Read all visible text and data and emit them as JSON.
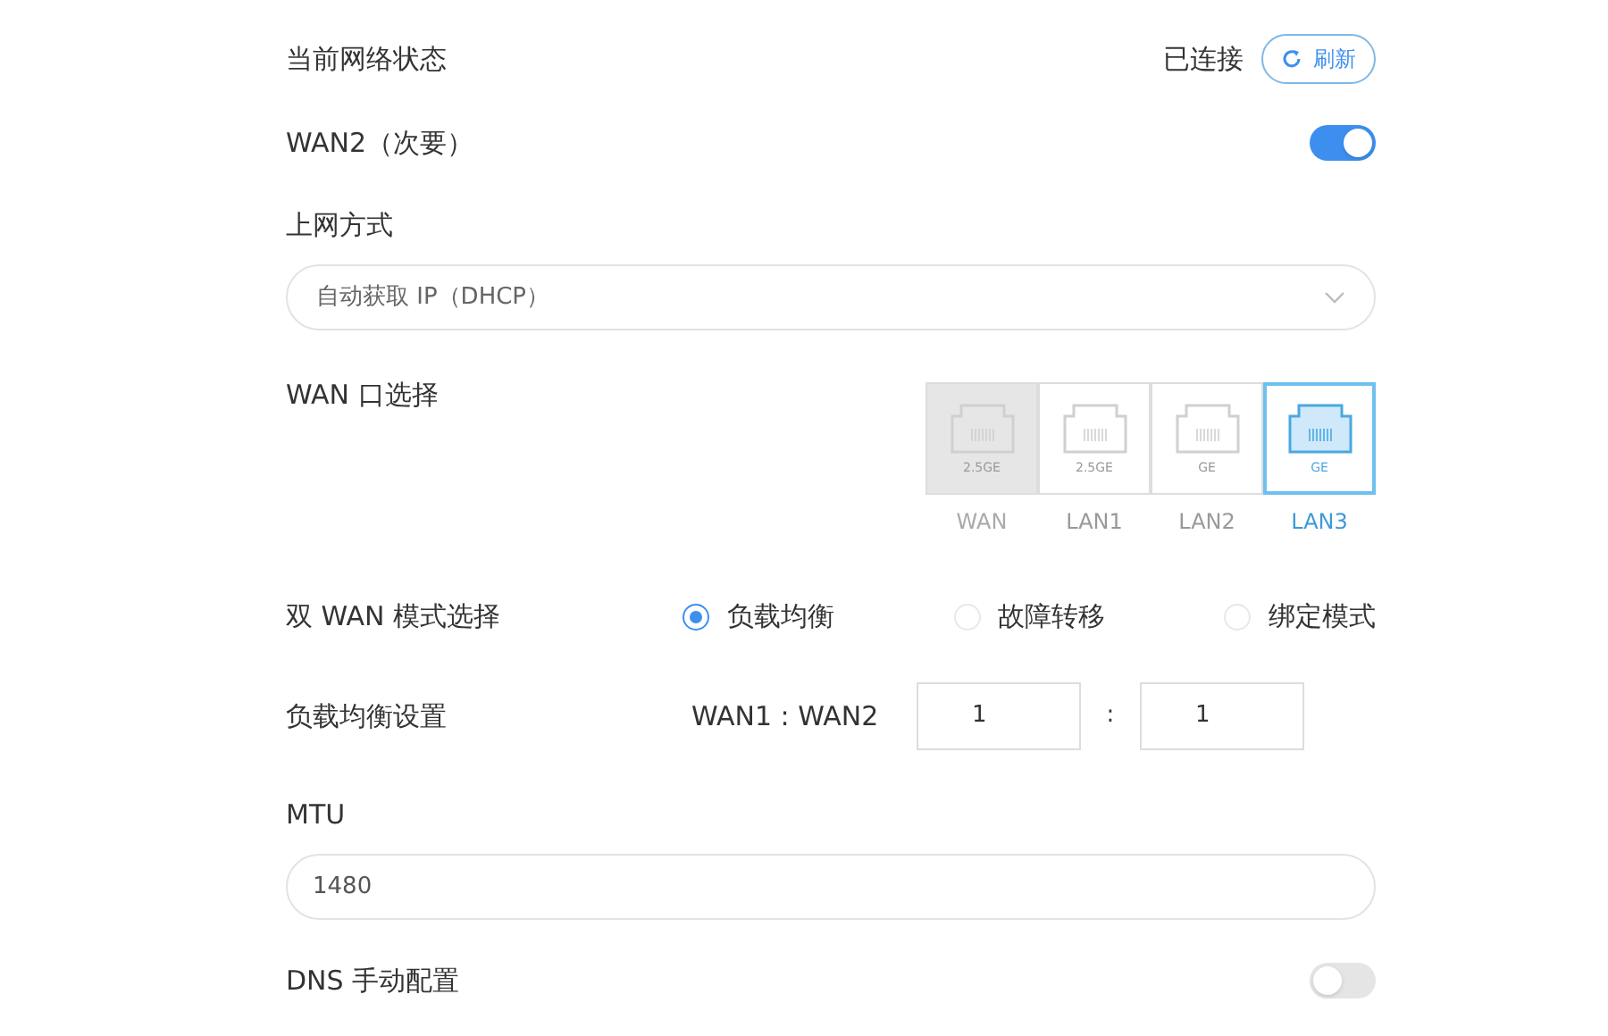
{
  "network_status": {
    "label": "当前网络状态",
    "status": "已连接",
    "refresh_button": "刷新"
  },
  "wan2": {
    "label": "WAN2（次要）",
    "on": true
  },
  "access_method": {
    "label": "上网方式",
    "value": "自动获取 IP（DHCP）"
  },
  "wan_port": {
    "label": "WAN 口选择",
    "ports": [
      {
        "name": "WAN",
        "speed": "2.5GE",
        "selected": false,
        "disabled": true
      },
      {
        "name": "LAN1",
        "speed": "2.5GE",
        "selected": false,
        "disabled": false
      },
      {
        "name": "LAN2",
        "speed": "GE",
        "selected": false,
        "disabled": false
      },
      {
        "name": "LAN3",
        "speed": "GE",
        "selected": true,
        "disabled": false
      }
    ]
  },
  "dual_wan_mode": {
    "label": "双 WAN 模式选择",
    "options": [
      {
        "label": "负载均衡",
        "selected": true
      },
      {
        "label": "故障转移",
        "selected": false
      },
      {
        "label": "绑定模式",
        "selected": false
      }
    ]
  },
  "load_balance": {
    "label": "负载均衡设置",
    "ratio_label": "WAN1 : WAN2",
    "wan1": "1",
    "separator": ":",
    "wan2": "1"
  },
  "mtu": {
    "label": "MTU",
    "value": "1480"
  },
  "dns": {
    "label": "DNS 手动配置",
    "on": false
  }
}
